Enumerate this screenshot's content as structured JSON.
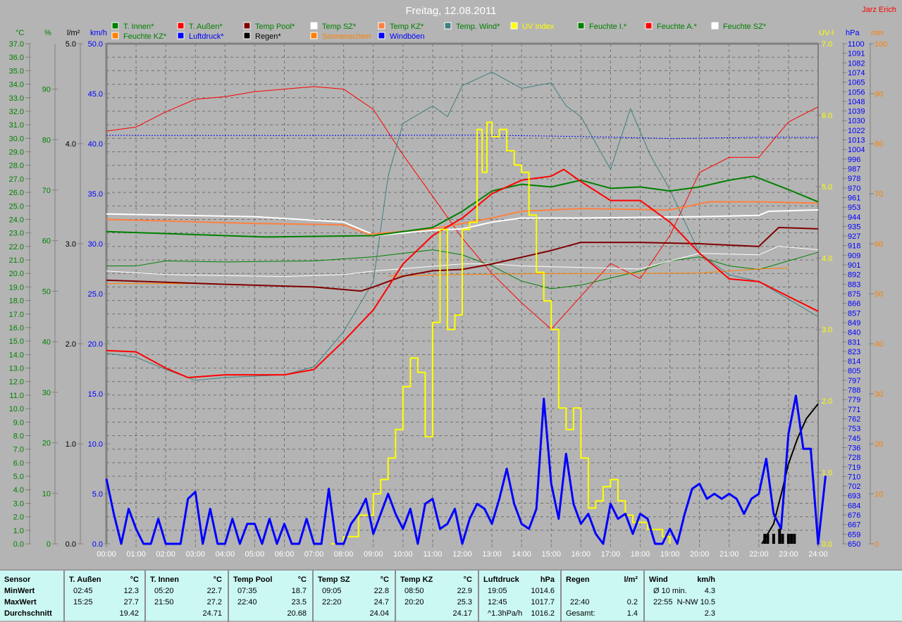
{
  "header": {
    "title": "Freitag, 12.08.2011",
    "author": "Jarz Erich"
  },
  "legend": [
    {
      "label": "T. Innen*",
      "color": "#008000",
      "text": "#008000"
    },
    {
      "label": "T. Außen*",
      "color": "#ff0000",
      "text": "#008000"
    },
    {
      "label": "Temp Pool*",
      "color": "#800000",
      "text": "#008000"
    },
    {
      "label": "Temp SZ*",
      "color": "#ffffff",
      "text": "#008000"
    },
    {
      "label": "Temp KZ*",
      "color": "#ff8040",
      "text": "#008000"
    },
    {
      "label": "Temp. Wind*",
      "color": "#408080",
      "text": "#008000"
    },
    {
      "label": "UV Index",
      "color": "#ffff00",
      "text": "#ffff00"
    },
    {
      "label": "Feuchte I.*",
      "color": "#008000",
      "text": "#008000"
    },
    {
      "label": "Feuchte A.*",
      "color": "#ff0000",
      "text": "#008000"
    },
    {
      "label": "Feuchte SZ*",
      "color": "#ffffff",
      "text": "#008000"
    },
    {
      "label": "Feuchte KZ*",
      "color": "#ff8000",
      "text": "#008000"
    },
    {
      "label": "Luftdruck*",
      "color": "#0000ff",
      "text": "#0000ff"
    },
    {
      "label": "Regen*",
      "color": "#000000",
      "text": "#000000"
    },
    {
      "label": "Sonnenschein",
      "color": "#ff8000",
      "text": "#ff8000"
    },
    {
      "label": "Windböen",
      "color": "#0000ff",
      "text": "#0000ff"
    }
  ],
  "chart_data": {
    "type": "line",
    "title": "Freitag, 12.08.2011",
    "x_range": [
      0,
      24
    ],
    "x_ticks": [
      "00:00",
      "01:00",
      "02:00",
      "03:00",
      "04:00",
      "05:00",
      "06:00",
      "07:00",
      "08:00",
      "09:00",
      "10:00",
      "11:00",
      "12:00",
      "13:00",
      "14:00",
      "15:00",
      "16:00",
      "17:00",
      "18:00",
      "19:00",
      "20:00",
      "21:00",
      "22:00",
      "23:00",
      "24:00"
    ],
    "axes": {
      "c": {
        "label": "°C",
        "range": [
          0,
          37
        ],
        "ticks": [
          "0.0",
          "1.0",
          "2.0",
          "3.0",
          "4.0",
          "5.0",
          "6.0",
          "7.0",
          "8.0",
          "9.0",
          "10.0",
          "11.0",
          "12.0",
          "13.0",
          "14.0",
          "15.0",
          "16.0",
          "17.0",
          "18.0",
          "19.0",
          "20.0",
          "21.0",
          "22.0",
          "23.0",
          "24.0",
          "25.0",
          "26.0",
          "27.0",
          "28.0",
          "29.0",
          "30.0",
          "31.0",
          "32.0",
          "33.0",
          "34.0",
          "35.0",
          "36.0",
          "37.0"
        ],
        "color": "#008000"
      },
      "pct": {
        "label": "%",
        "range": [
          0,
          99
        ],
        "ticks": [
          "0",
          "10",
          "20",
          "30",
          "40",
          "50",
          "60",
          "70",
          "80",
          "90"
        ],
        "color": "#008000"
      },
      "lm2": {
        "label": "l/m²",
        "range": [
          0,
          5
        ],
        "ticks": [
          "0.0",
          "1.0",
          "2.0",
          "3.0",
          "4.0",
          "5.0"
        ],
        "color": "#000000"
      },
      "kmh": {
        "label": "km/h",
        "range": [
          0,
          50
        ],
        "ticks": [
          "0.0",
          "5.0",
          "10.0",
          "15.0",
          "20.0",
          "25.0",
          "30.0",
          "35.0",
          "40.0",
          "45.0",
          "50.0"
        ],
        "color": "#0000ff"
      },
      "uv": {
        "label": "UV-I",
        "range": [
          0,
          7
        ],
        "ticks": [
          "0.0",
          "1.0",
          "2.0",
          "3.0",
          "4.0",
          "5.0",
          "6.0",
          "7.0"
        ],
        "color": "#ffff00"
      },
      "hpa": {
        "label": "hPa",
        "range": [
          650,
          1100
        ],
        "ticks": [
          "650",
          "659",
          "667",
          "676",
          "684",
          "693",
          "702",
          "710",
          "719",
          "728",
          "736",
          "745",
          "753",
          "762",
          "771",
          "779",
          "788",
          "797",
          "805",
          "814",
          "823",
          "831",
          "840",
          "849",
          "857",
          "866",
          "875",
          "883",
          "892",
          "901",
          "909",
          "918",
          "927",
          "935",
          "944",
          "953",
          "961",
          "970",
          "978",
          "987",
          "996",
          "1004",
          "1013",
          "1022",
          "1030",
          "1039",
          "1048",
          "1056",
          "1065",
          "1074",
          "1082",
          "1091",
          "1100"
        ],
        "color": "#0000ff"
      },
      "min": {
        "label": "min",
        "range": [
          0,
          100
        ],
        "ticks": [
          "0",
          "10",
          "20",
          "30",
          "40",
          "50",
          "60",
          "70",
          "80",
          "90",
          "100"
        ],
        "color": "#ff8000"
      }
    },
    "series": [
      {
        "name": "Feuchte A.",
        "axis": "pct",
        "color": "#ff0000",
        "width": 1,
        "x": [
          0,
          1,
          2,
          3,
          4,
          5,
          6,
          7,
          8,
          9,
          10,
          11,
          12,
          13,
          14,
          15,
          16,
          17,
          18,
          19,
          20,
          21,
          22,
          23,
          24
        ],
        "y": [
          81.7,
          82.5,
          85.5,
          88,
          88.5,
          89.5,
          90,
          90.5,
          90,
          86,
          77,
          68.8,
          60.5,
          53.5,
          47.7,
          42.5,
          49,
          55.5,
          52.5,
          61,
          73.5,
          76.5,
          76.5,
          83.5,
          86.5
        ]
      },
      {
        "name": "Feuchte I.",
        "axis": "pct",
        "color": "#008000",
        "width": 1,
        "x": [
          0,
          1,
          2,
          4,
          7,
          9,
          10,
          11,
          12,
          13,
          14,
          15,
          16,
          17,
          18,
          19,
          20,
          21,
          22,
          23,
          24
        ],
        "y": [
          55,
          55,
          56,
          55.8,
          56,
          56.8,
          57.5,
          58.2,
          57.2,
          55,
          52,
          50.5,
          51.2,
          52.6,
          54,
          56,
          56.8,
          55,
          54.3,
          56,
          57.7
        ]
      },
      {
        "name": "Feuchte SZ",
        "axis": "pct",
        "color": "#ffffff",
        "width": 1,
        "x": [
          0,
          2,
          6,
          8,
          9,
          12,
          13,
          14,
          16,
          18,
          19,
          20,
          22,
          22.67,
          24
        ],
        "y": [
          54,
          53.3,
          52.9,
          53.3,
          54,
          55.4,
          55.4,
          55,
          54.7,
          54.4,
          56,
          57.5,
          57.2,
          58.9,
          58.2
        ]
      },
      {
        "name": "Feuchte KZ",
        "axis": "pct",
        "color": "#ff8000",
        "width": 1,
        "x": [
          0,
          2.8,
          null,
          9.5,
          12,
          15,
          17,
          20,
          22,
          23
        ],
        "y": [
          51.5,
          51.5,
          null,
          53,
          53.3,
          53.5,
          53.5,
          53.6,
          54.4,
          54.6
        ]
      },
      {
        "name": "Temp. Wind",
        "axis": "c",
        "color": "#408080",
        "width": 1,
        "x": [
          0,
          1,
          2,
          3,
          4,
          5,
          6,
          7,
          8,
          9,
          9.5,
          10,
          11,
          11.5,
          12,
          13,
          14,
          15,
          15.5,
          16,
          17,
          17.67,
          18.33,
          19,
          20,
          21,
          22,
          23,
          24
        ],
        "y": [
          14.1,
          13.8,
          12.9,
          12.1,
          12.3,
          12.4,
          12.5,
          13.1,
          15.7,
          19.4,
          27.2,
          31.1,
          32.4,
          31.6,
          33.9,
          34.9,
          33.7,
          34.1,
          32.4,
          31.6,
          27.7,
          32.2,
          28.8,
          26.2,
          21.5,
          19.9,
          19.4,
          18.1,
          16.8
        ]
      },
      {
        "name": "Temp Pool",
        "axis": "c",
        "color": "#800000",
        "width": 2,
        "x": [
          0,
          4,
          7,
          8.58,
          9,
          10,
          11,
          12,
          13,
          14,
          15,
          16,
          18,
          20,
          22,
          22.67,
          24
        ],
        "y": [
          19.5,
          19.2,
          19,
          18.7,
          19,
          19.8,
          20.2,
          20.3,
          20.7,
          21.2,
          21.7,
          22.3,
          22.3,
          22.2,
          22,
          23.4,
          23.3
        ]
      },
      {
        "name": "Temp SZ",
        "axis": "c",
        "color": "#ffffff",
        "width": 2,
        "x": [
          0,
          5,
          8,
          9.08,
          11,
          12,
          13,
          14,
          16,
          20,
          22,
          22.33,
          24
        ],
        "y": [
          24.4,
          24.2,
          23.8,
          22.8,
          23.2,
          23.3,
          23.8,
          24.1,
          24.1,
          24.2,
          24.3,
          24.6,
          24.7
        ]
      },
      {
        "name": "Temp KZ",
        "axis": "c",
        "color": "#ff8040",
        "width": 2,
        "x": [
          0,
          5,
          8,
          8.83,
          11,
          13,
          14,
          16,
          19,
          20.33,
          22,
          24
        ],
        "y": [
          24,
          23.7,
          23.6,
          22.9,
          23.3,
          24.1,
          24.6,
          24.8,
          24.7,
          25.3,
          25.3,
          25.2
        ]
      },
      {
        "name": "T. Innen",
        "axis": "c",
        "color": "#008000",
        "width": 2,
        "x": [
          0,
          5.33,
          9,
          11,
          12,
          13,
          14,
          15,
          16,
          17,
          18,
          19,
          20,
          21,
          21.83,
          23,
          24
        ],
        "y": [
          23.1,
          22.7,
          22.8,
          23.4,
          24.6,
          26.1,
          26.6,
          26.4,
          26.9,
          26.3,
          26.4,
          26.1,
          26.4,
          26.9,
          27.2,
          26.2,
          25.3
        ]
      },
      {
        "name": "T. Außen",
        "axis": "c",
        "color": "#ff0000",
        "width": 2,
        "x": [
          0,
          1,
          2,
          2.75,
          4,
          6,
          7,
          8,
          9,
          10,
          11,
          12,
          13,
          14,
          15,
          15.42,
          16,
          17,
          18,
          19,
          20,
          21,
          22,
          23,
          24
        ],
        "y": [
          14.3,
          14.2,
          13,
          12.3,
          12.5,
          12.5,
          12.9,
          15,
          17.3,
          20.7,
          22.8,
          24.1,
          25.9,
          26.9,
          27.2,
          27.7,
          26.8,
          25.4,
          25.4,
          23.8,
          21.5,
          19.6,
          19.4,
          18.3,
          17.2
        ]
      },
      {
        "name": "Luftdruck",
        "axis": "hpa",
        "color": "#0000ff",
        "width": 1,
        "dash": "2,2",
        "x": [
          0,
          6,
          12.75,
          16,
          19.08,
          22,
          24
        ],
        "y": [
          1017.5,
          1017.4,
          1017.7,
          1016.5,
          1014.6,
          1015.8,
          1015.7
        ]
      },
      {
        "name": "UV Index",
        "axis": "uv",
        "color": "#ffff00",
        "width": 2,
        "step": true,
        "x": [
          7.58,
          8,
          8.5,
          9,
          9.25,
          9.5,
          9.75,
          10,
          10.25,
          10.5,
          10.75,
          11,
          11.25,
          11.5,
          11.75,
          12,
          12.25,
          12.5,
          12.67,
          12.83,
          13,
          13.25,
          13.5,
          13.75,
          14,
          14.25,
          14.5,
          14.75,
          15,
          15.25,
          15.5,
          15.75,
          16,
          16.25,
          16.5,
          16.75,
          17,
          17.25,
          17.5,
          17.75,
          18,
          18.25,
          18.5,
          18.75,
          19
        ],
        "y": [
          0,
          0.1,
          0.4,
          0.7,
          0.9,
          1.2,
          1.6,
          2.2,
          2.6,
          2.4,
          1.5,
          3.1,
          4.4,
          3.0,
          3.2,
          4.4,
          4.5,
          5.8,
          5.2,
          5.9,
          5.7,
          5.8,
          5.5,
          5.3,
          5.2,
          4.6,
          3.8,
          3.4,
          3.0,
          1.9,
          1.6,
          1.9,
          1.2,
          0.5,
          0.6,
          0.8,
          0.9,
          0.6,
          0.4,
          0.3,
          0.3,
          0.2,
          0.2,
          0.1,
          0
        ]
      },
      {
        "name": "Regen",
        "axis": "lm2",
        "color": "#000000",
        "width": 2,
        "x": [
          22.1,
          22.5,
          22.8,
          23,
          23.3,
          23.6,
          24
        ],
        "y": [
          0,
          0.2,
          0.55,
          0.8,
          1.05,
          1.25,
          1.4
        ]
      },
      {
        "name": "Windböen",
        "axis": "kmh",
        "color": "#0000ff",
        "width": 3,
        "x_step": 0.25,
        "y": [
          6.5,
          3,
          0,
          3.5,
          1.5,
          0,
          0,
          2.5,
          0,
          0,
          0,
          4.5,
          5.2,
          0,
          3.5,
          0,
          0,
          2.5,
          0,
          2,
          2,
          0,
          2.5,
          0,
          2,
          0,
          0,
          2.5,
          0,
          0,
          5.5,
          0,
          0,
          2,
          3,
          4.5,
          1,
          3,
          5,
          3,
          1.5,
          3.5,
          0,
          4,
          4.5,
          1.5,
          2,
          3.5,
          0,
          2.5,
          4,
          3.5,
          2,
          4.5,
          7.5,
          4,
          2,
          1.5,
          3.5,
          14.5,
          6,
          2.5,
          9,
          4,
          2,
          3,
          1,
          0,
          4,
          2.5,
          3,
          1,
          3,
          2.5,
          0,
          0,
          1.5,
          0,
          3,
          5.5,
          6,
          4.5,
          5,
          4.5,
          5,
          4.5,
          3,
          4.5,
          5,
          8.5,
          3,
          1.5,
          11,
          14.8,
          9.5,
          9.5,
          0,
          6.8
        ]
      }
    ],
    "rain_bars": {
      "axis": "lm2",
      "x": [
        22.2,
        22.3,
        22.5,
        22.7,
        22.8,
        23,
        23.1,
        23.2
      ],
      "y": [
        0.1,
        0.1,
        0.1,
        0.15,
        0.1,
        0.1,
        0.1,
        0.1
      ]
    }
  },
  "table": {
    "columns": [
      {
        "head": "Sensor",
        "unit": "",
        "rows": [
          [
            "MinWert",
            ""
          ],
          [
            "MaxWert",
            ""
          ],
          [
            "Durchschnitt",
            ""
          ]
        ],
        "label": true
      },
      {
        "head": "T. Außen",
        "unit": "°C",
        "rows": [
          [
            "02:45",
            "12.3"
          ],
          [
            "15:25",
            "27.7"
          ],
          [
            "",
            "19.42"
          ]
        ]
      },
      {
        "head": "T. Innen",
        "unit": "°C",
        "rows": [
          [
            "05:20",
            "22.7"
          ],
          [
            "21:50",
            "27.2"
          ],
          [
            "",
            "24.71"
          ]
        ]
      },
      {
        "head": "Temp Pool",
        "unit": "°C",
        "rows": [
          [
            "07:35",
            "18.7"
          ],
          [
            "22:40",
            "23.5"
          ],
          [
            "",
            "20.68"
          ]
        ]
      },
      {
        "head": "Temp SZ",
        "unit": "°C",
        "rows": [
          [
            "09:05",
            "22.8"
          ],
          [
            "22:20",
            "24.7"
          ],
          [
            "",
            "24.04"
          ]
        ]
      },
      {
        "head": "Temp KZ",
        "unit": "°C",
        "rows": [
          [
            "08:50",
            "22.9"
          ],
          [
            "20:20",
            "25.3"
          ],
          [
            "",
            "24.17"
          ]
        ]
      },
      {
        "head": "Luftdruck",
        "unit": "hPa",
        "rows": [
          [
            "19:05",
            "1014.6"
          ],
          [
            "12:45",
            "1017.7"
          ],
          [
            "^1.3hPa/h",
            "1016.2"
          ]
        ]
      },
      {
        "head": "Regen",
        "unit": "l/m²",
        "rows": [
          [
            "",
            ""
          ],
          [
            "22:40",
            "0.2"
          ],
          [
            "Gesamt:",
            "1.4"
          ]
        ]
      },
      {
        "head": "Wind",
        "unit": "km/h",
        "rows": [
          [
            "Ø 10 min.",
            "4.3"
          ],
          [
            "22:55",
            "N-NW 10.5"
          ],
          [
            "",
            "2.3"
          ]
        ]
      }
    ]
  }
}
